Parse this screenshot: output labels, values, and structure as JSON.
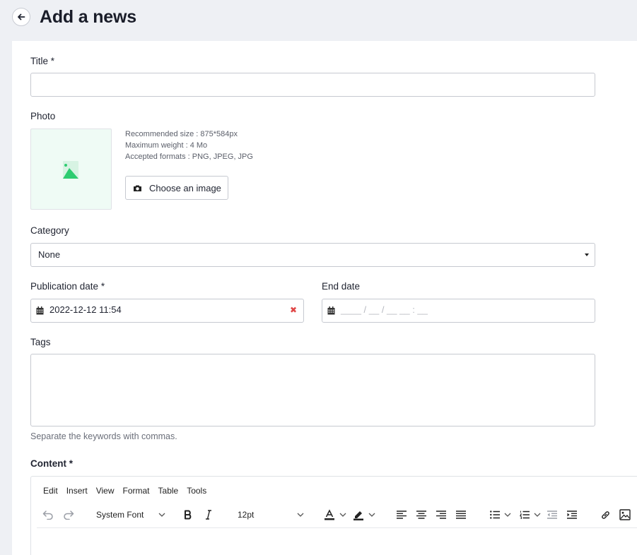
{
  "page": {
    "title": "Add a news"
  },
  "form": {
    "title_label": "Title *",
    "title_value": "",
    "photo_label": "Photo",
    "photo_info": [
      "Recommended size : 875*584px",
      "Maximum weight : 4 Mo",
      "Accepted formats : PNG, JPEG, JPG"
    ],
    "choose_image_label": "Choose an image",
    "category_label": "Category",
    "category_value": "None",
    "publication_label": "Publication date *",
    "publication_value": "2022-12-12 11:54",
    "end_label": "End date",
    "end_placeholder": "____ / __ / __ __ : __",
    "tags_label": "Tags",
    "tags_help": "Separate the keywords with commas.",
    "content_label": "Content *"
  },
  "editor": {
    "menu": [
      "Edit",
      "Insert",
      "View",
      "Format",
      "Table",
      "Tools"
    ],
    "font_family": "System Font",
    "font_size": "12pt"
  },
  "colors": {
    "background": "#eef0f4",
    "card": "#ffffff",
    "photo_accent": "#2ecc71",
    "clear_icon": "#e04646"
  }
}
